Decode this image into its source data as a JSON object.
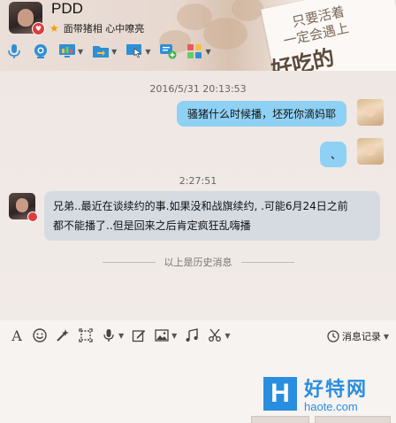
{
  "header": {
    "title": "PDD",
    "status_text": "面带猪相 心中嘹亮",
    "deco_line1": "只要活着",
    "deco_line2": "一定会遇上",
    "deco_line3": "好吃的"
  },
  "toolbar": {
    "icons": [
      "microphone-icon",
      "video-call-icon",
      "screen-share-icon",
      "file-transfer-icon",
      "remote-desktop-icon",
      "add-contact-icon",
      "apps-icon"
    ]
  },
  "chat": {
    "timestamp1": "2016/5/31 20:13:53",
    "msg1": "骚猪什么时候播，坯死你滴妈耶",
    "msg2": "、",
    "timestamp2": "2:27:51",
    "msg3_line1": "兄弟..最近在谈续约的事.如果没和战旗续约, .可能6月24日之前",
    "msg3_line2": "都不能播了..但是回来之后肯定疯狂乱嗨播",
    "history_label": "以上是历史消息"
  },
  "input": {
    "history_button": "消息记录"
  },
  "brand": {
    "logo_letter": "H",
    "name": "好特网",
    "domain": "haote.com"
  },
  "colors": {
    "bubble_self": "#8fd1f4",
    "bubble_other": "#d6dbe2",
    "brand_blue": "#2a8ee0"
  }
}
